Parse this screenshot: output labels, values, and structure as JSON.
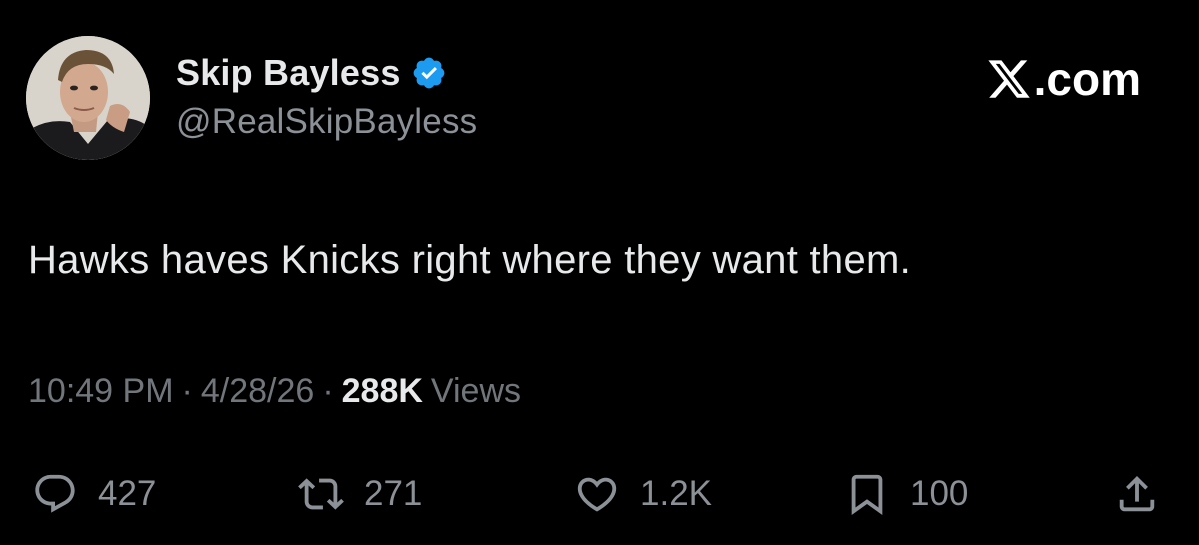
{
  "author": {
    "display_name": "Skip Bayless",
    "handle": "@RealSkipBayless",
    "verified": true,
    "verified_color": "#1d9bf0"
  },
  "site_logo": {
    "text": ".com",
    "icon": "x-logo-icon"
  },
  "tweet": {
    "text": "Hawks haves Knicks right where they want them."
  },
  "meta": {
    "time": "10:49 PM",
    "separator": "·",
    "date": "4/28/26",
    "views_count": "288K",
    "views_label": "Views"
  },
  "actions": {
    "reply": {
      "icon": "reply-icon",
      "count": "427"
    },
    "repost": {
      "icon": "repost-icon",
      "count": "271"
    },
    "like": {
      "icon": "heart-icon",
      "count": "1.2K"
    },
    "bookmark": {
      "icon": "bookmark-icon",
      "count": "100"
    },
    "share": {
      "icon": "share-icon"
    }
  },
  "colors": {
    "background": "#000000",
    "primary_text": "#e7e9ea",
    "secondary_text": "#71767b",
    "verified_blue": "#1d9bf0"
  }
}
